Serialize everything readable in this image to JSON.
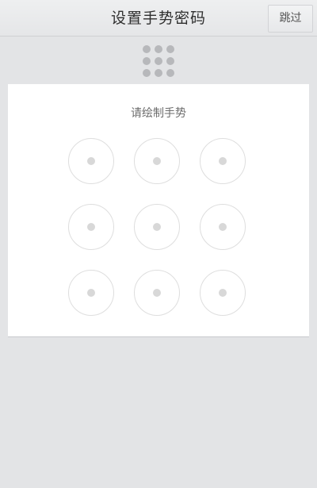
{
  "header": {
    "title": "设置手势密码",
    "skip_label": "跳过"
  },
  "gesture_card": {
    "prompt": "请绘制手势"
  },
  "colors": {
    "page_background": "#e3e4e6",
    "card_background": "#ffffff",
    "preview_dot": "#b7b8bb",
    "node_ring": "#dedede",
    "node_center": "#d8d8d8"
  }
}
